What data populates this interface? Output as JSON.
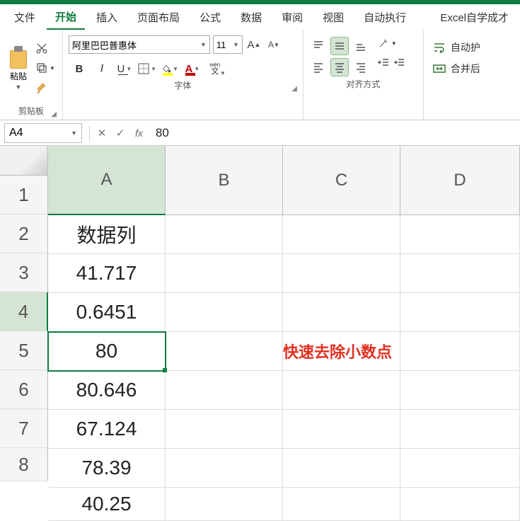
{
  "menubar": {
    "items": [
      "文件",
      "开始",
      "插入",
      "页面布局",
      "公式",
      "数据",
      "审阅",
      "视图",
      "自动执行"
    ],
    "active_index": 1,
    "right_label": "Excel自学成才"
  },
  "ribbon": {
    "clipboard": {
      "paste_label": "粘贴",
      "group_label": "剪贴板"
    },
    "font": {
      "name": "阿里巴巴普惠体",
      "size": "11",
      "wen_label": "wén",
      "wen_sub": "文",
      "group_label": "字体"
    },
    "alignment": {
      "group_label": "对齐方式"
    },
    "wrap": {
      "auto_wrap": "自动护",
      "merge": "合并后"
    }
  },
  "formula_bar": {
    "name_box": "A4",
    "fx": "fx",
    "value": "80"
  },
  "sheet": {
    "columns": [
      "A",
      "B",
      "C",
      "D"
    ],
    "selected_col_index": 0,
    "rows": [
      "1",
      "2",
      "3",
      "4",
      "5",
      "6",
      "7",
      "8"
    ],
    "selected_row_index": 3,
    "colA": [
      "数据列",
      "41.717",
      "0.6451",
      "80",
      "80.646",
      "67.124",
      "78.39",
      "40.25"
    ],
    "annotation": "快速去除小数点",
    "selected_cell": "A4"
  },
  "chart_data": {
    "type": "table",
    "title": "数据列",
    "columns": [
      "数据列"
    ],
    "values": [
      41.717,
      0.6451,
      80,
      80.646,
      67.124,
      78.39,
      40.25
    ]
  }
}
